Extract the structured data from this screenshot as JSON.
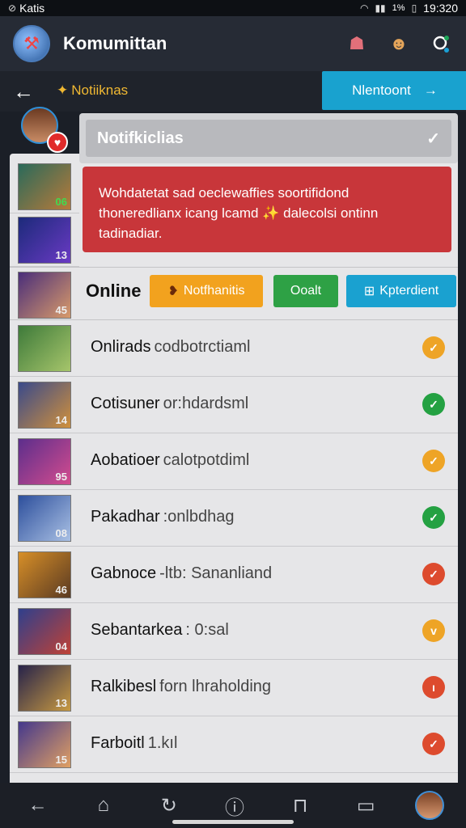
{
  "status_bar": {
    "carrier": "Katis",
    "battery": "1%",
    "time": "19:320"
  },
  "app": {
    "title": "Komumittan"
  },
  "sub_header": {
    "title": "Notiiknas",
    "next_label": "Nlentoont"
  },
  "panel": {
    "header": "Notifkiclias",
    "alert_text": "Wohdatetat sad oeclewaffies soortifidond thoneredlianx icang lcamd ✨ dalecolsi ontinn tadinadiar."
  },
  "online_bar": {
    "label": "Online",
    "buttons": [
      {
        "label": "Notfhanitis",
        "color": "#f2a21e",
        "icon": "bell-icon"
      },
      {
        "label": "Ooalt",
        "color": "#2ea145",
        "icon": ""
      },
      {
        "label": "Kpterdient",
        "color": "#1aa1d0",
        "icon": "grid-icon"
      }
    ]
  },
  "thumbnails_top": [
    {
      "badge": "06"
    },
    {
      "badge": "13"
    },
    {
      "badge": "45"
    }
  ],
  "notifications": [
    {
      "name": "Onlirads",
      "detail": "codbotrctiaml",
      "badge": "",
      "status": "orange",
      "status_glyph": "✓",
      "thumb": [
        "#3e7a3a",
        "#a6c56b"
      ]
    },
    {
      "name": "Cotisuner",
      "detail": "or:hdardsml",
      "badge": "14",
      "status": "green",
      "status_glyph": "✓",
      "thumb": [
        "#3a4a8a",
        "#d0903c"
      ]
    },
    {
      "name": "Aobatioer",
      "detail": "calotpotdiml",
      "badge": "95",
      "status": "orange",
      "status_glyph": "✓",
      "thumb": [
        "#5c2e8c",
        "#d44c8e"
      ]
    },
    {
      "name": "Pakadhar",
      "detail": ":onlbdhag",
      "badge": "08",
      "status": "green",
      "status_glyph": "✓",
      "thumb": [
        "#2d4f9c",
        "#a9c0e4"
      ]
    },
    {
      "name": "Gabnoce",
      "detail": "-ltb: Sananliand",
      "badge": "46",
      "status": "red",
      "status_glyph": "✓",
      "thumb": [
        "#d78f28",
        "#5a3a22"
      ]
    },
    {
      "name": "Sebantarkea",
      "detail": ": 0:sal",
      "badge": "04",
      "status": "orange",
      "status_glyph": "v",
      "thumb": [
        "#2f3f8c",
        "#c04236"
      ]
    },
    {
      "name": "Ralkibesl",
      "detail": "forn lhraholding",
      "badge": "13",
      "status": "red",
      "status_glyph": "ı",
      "thumb": [
        "#27234a",
        "#c89a42"
      ]
    },
    {
      "name": "Farboitl",
      "detail": "1.kıl",
      "badge": "15",
      "status": "red",
      "status_glyph": "✓",
      "thumb": [
        "#44388c",
        "#e0a063"
      ]
    }
  ],
  "colors": {
    "orange": "#eea426",
    "green": "#24a142",
    "red": "#dd4b2e"
  },
  "nav": [
    {
      "icon": "back-icon"
    },
    {
      "icon": "home-icon"
    },
    {
      "icon": "refresh-icon"
    },
    {
      "icon": "info-icon"
    },
    {
      "icon": "book-icon"
    },
    {
      "icon": "monitor-icon"
    },
    {
      "icon": "avatar"
    }
  ]
}
